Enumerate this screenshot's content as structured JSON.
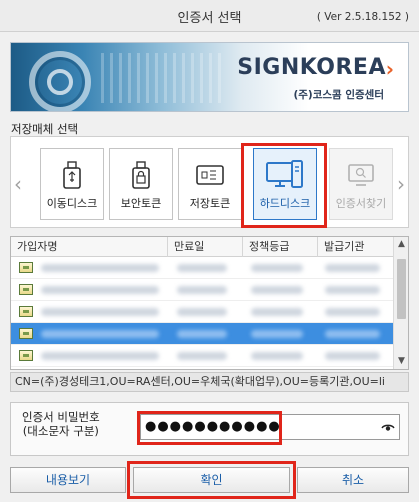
{
  "window": {
    "title": "인증서 선택",
    "version": "( Ver 2.5.18.152 )"
  },
  "banner": {
    "brand": "SIGNKOREA",
    "subtitle": "(주)코스콤 인증센터"
  },
  "storage": {
    "label": "저장매체 선택",
    "items": [
      {
        "label": "이동디스크",
        "icon": "usb-drive-icon",
        "state": "normal"
      },
      {
        "label": "보안토큰",
        "icon": "security-token-icon",
        "state": "normal"
      },
      {
        "label": "저장토큰",
        "icon": "storage-token-icon",
        "state": "normal"
      },
      {
        "label": "하드디스크",
        "icon": "hard-disk-icon",
        "state": "selected"
      },
      {
        "label": "인증서찾기",
        "icon": "find-certificate-icon",
        "state": "disabled"
      }
    ]
  },
  "table": {
    "columns": [
      "가입자명",
      "만료일",
      "정책등급",
      "발급기관"
    ],
    "selected_row": 3
  },
  "dn_text": "CN=(주)경성테크1,OU=RA센터,OU=우체국(확대업무),OU=등록기관,OU=li",
  "password": {
    "label_line1": "인증서 비밀번호",
    "label_line2": "(대소문자 구분)",
    "masked_value": "●●●●●●●●●●●"
  },
  "buttons": {
    "view": "내용보기",
    "confirm": "확인",
    "cancel": "취소"
  },
  "colors": {
    "accent": "#2d78c9",
    "highlight_red": "#e0251a",
    "selected_row": "#3d8ee0"
  }
}
